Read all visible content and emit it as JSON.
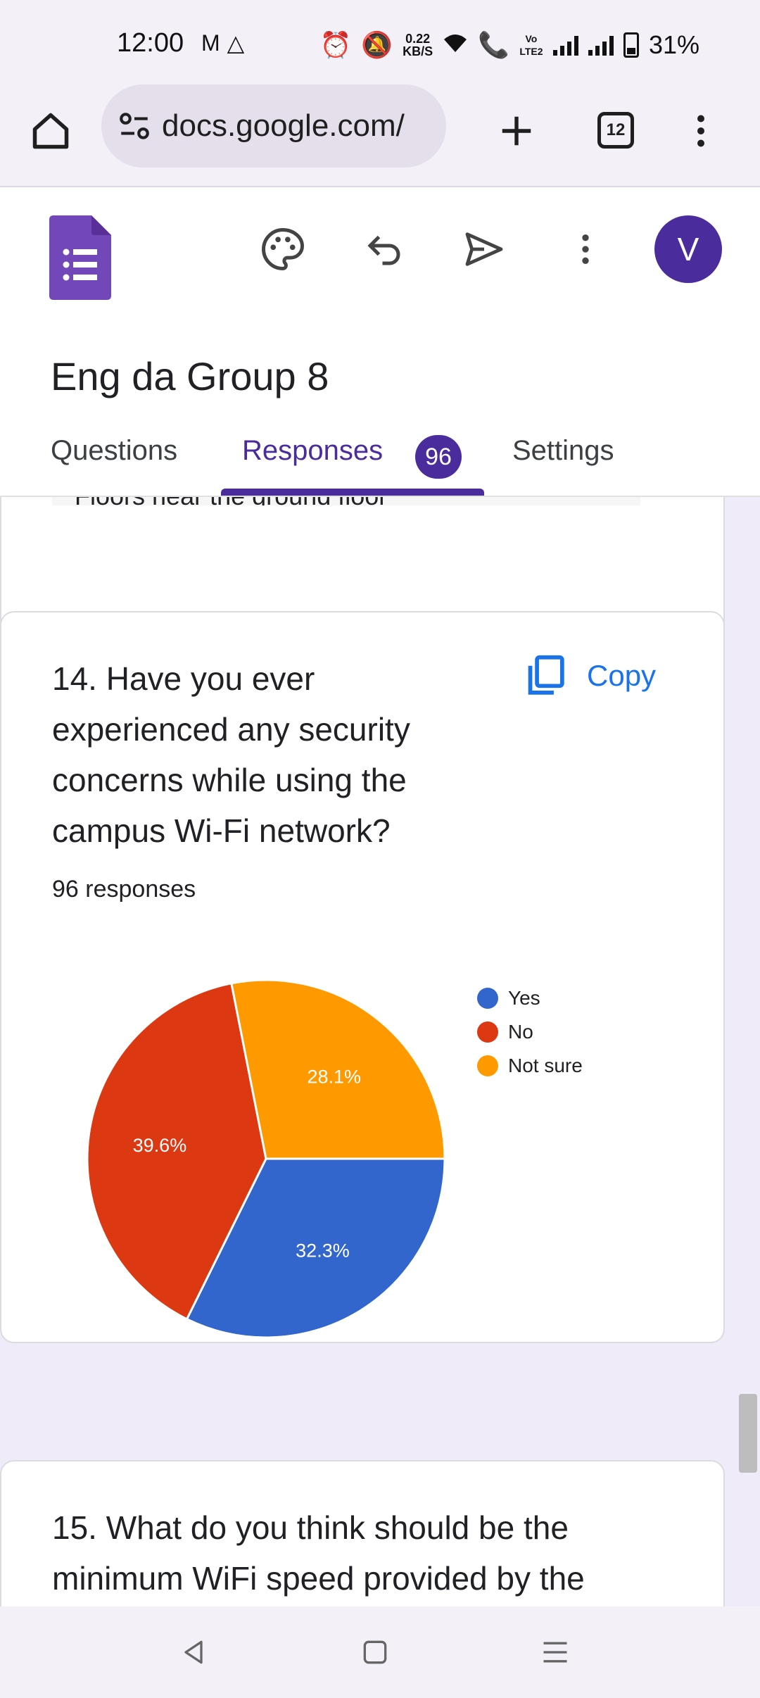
{
  "status_bar": {
    "time": "12:00",
    "speed_value": "0.22",
    "speed_unit": "KB/S",
    "volte": "Vo LTE2",
    "battery": "31%"
  },
  "browser": {
    "url": "docs.google.com/",
    "tab_count": "12"
  },
  "forms": {
    "avatar_letter": "V",
    "title": "Eng da Group 8",
    "tabs": [
      {
        "label": "Questions"
      },
      {
        "label": "Responses"
      },
      {
        "label": "Settings"
      }
    ],
    "responses_badge": "96"
  },
  "prev_card": {
    "answer_text": "Floors near the ground floor"
  },
  "q14": {
    "title": "14. Have you ever experienced any security concerns while using the campus Wi-Fi network?",
    "copy_label": "Copy",
    "response_count": "96 responses"
  },
  "chart_data": {
    "type": "pie",
    "categories": [
      "Yes",
      "No",
      "Not sure"
    ],
    "values": [
      32.3,
      39.6,
      28.1
    ],
    "labels": [
      "32.3%",
      "39.6%",
      "28.1%"
    ],
    "colors": [
      "#3366cc",
      "#dc3912",
      "#ff9900"
    ],
    "legend_position": "right"
  },
  "q15": {
    "title": "15. What do you think should be the minimum WiFi speed provided by the"
  },
  "colors": {
    "accent": "#4b2c9c",
    "link": "#1a73e8",
    "background": "#f0ebf8"
  }
}
